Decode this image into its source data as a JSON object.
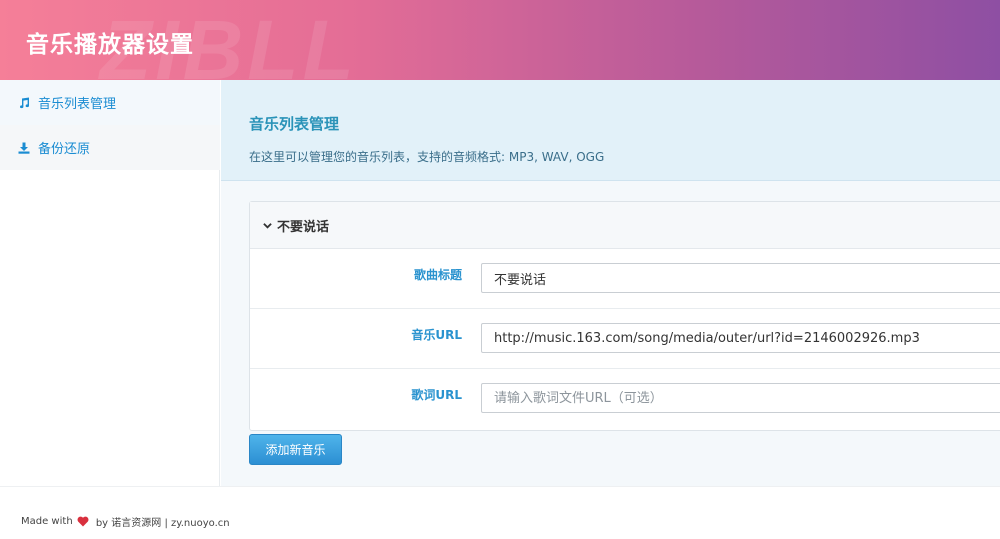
{
  "header": {
    "title": "音乐播放器设置",
    "watermark": "ZIBLL"
  },
  "sidebar": {
    "items": [
      {
        "label": "音乐列表管理",
        "icon": "music-note-icon",
        "active": true
      },
      {
        "label": "备份还原",
        "icon": "download-icon",
        "active": false
      }
    ]
  },
  "main": {
    "section_title": "音乐列表管理",
    "section_desc": "在这里可以管理您的音乐列表，支持的音频格式: MP3, WAV, OGG",
    "song": {
      "header": "不要说话",
      "fields": [
        {
          "label": "歌曲标题",
          "value": "不要说话",
          "placeholder": ""
        },
        {
          "label": "音乐URL",
          "value": "http://music.163.com/song/media/outer/url?id=2146002926.mp3",
          "placeholder": ""
        },
        {
          "label": "歌词URL",
          "value": "",
          "placeholder": "请输入歌词文件URL（可选）"
        }
      ]
    },
    "add_button": "添加新音乐"
  },
  "footer": {
    "made_with": "Made with",
    "by_text": " by 诺言资源网 | zy.nuoyo.cn"
  },
  "colors": {
    "accent": "#1a8cd2",
    "header_start": "#f57f98",
    "header_end": "#8e4fa3",
    "heart": "#d9303e"
  }
}
